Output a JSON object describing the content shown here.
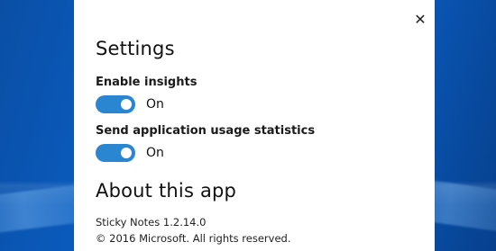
{
  "window": {
    "close_icon": "close-icon"
  },
  "settings": {
    "title": "Settings",
    "items": [
      {
        "label": "Enable insights",
        "state": "On"
      },
      {
        "label": "Send application usage statistics",
        "state": "On"
      }
    ]
  },
  "about": {
    "title": "About this app",
    "app_name": "Sticky Notes",
    "version": "1.2.14.0",
    "copyright": "© 2016 Microsoft. All rights reserved."
  },
  "colors": {
    "accent": "#2a86d1",
    "panel_background": "#ffffff",
    "desktop_background": "#0a5cc0"
  }
}
